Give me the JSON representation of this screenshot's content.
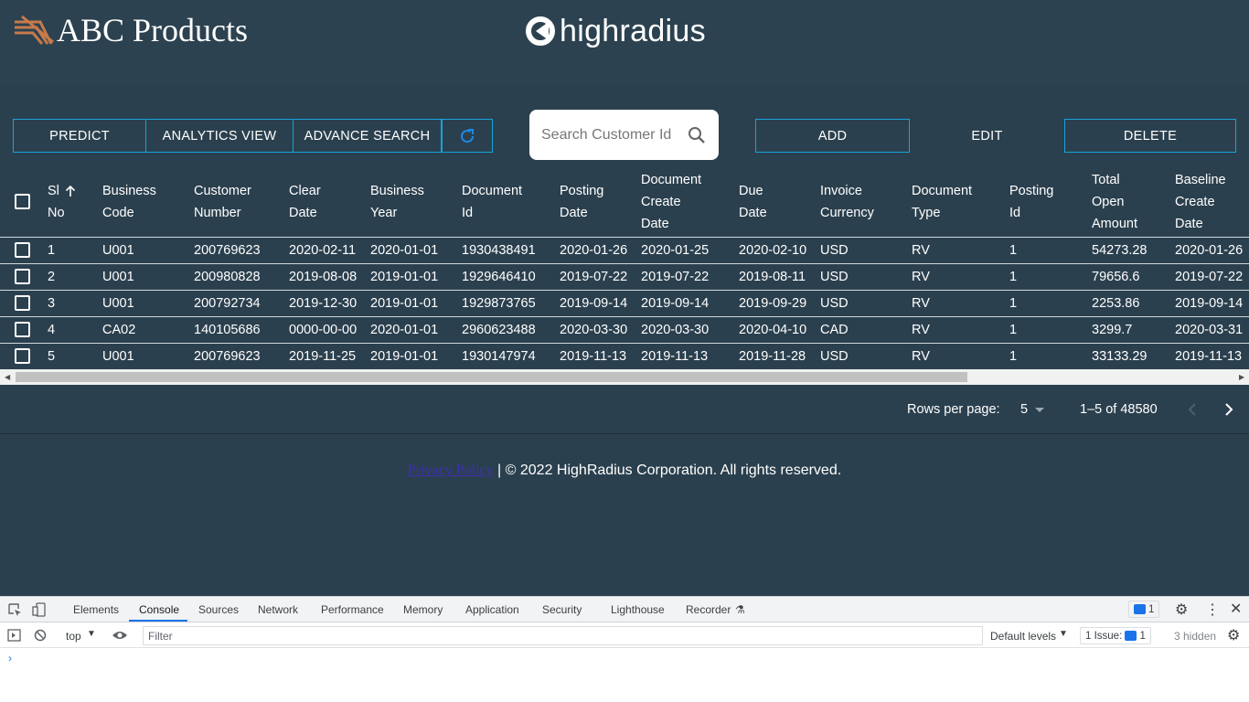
{
  "header": {
    "brand": "ABC Products",
    "partner_logo": "highradius"
  },
  "toolbar": {
    "predict": "PREDICT",
    "analytics": "ANALYTICS VIEW",
    "advance_search": "ADVANCE SEARCH",
    "refresh_icon": "refresh-icon",
    "add": "ADD",
    "edit": "EDIT",
    "delete": "DELETE"
  },
  "search": {
    "placeholder": "Search Customer Id",
    "icon": "search-icon"
  },
  "table": {
    "columns": [
      [
        "Sl",
        "No"
      ],
      [
        "Business",
        "Code"
      ],
      [
        "Customer",
        "Number"
      ],
      [
        "Clear",
        "Date"
      ],
      [
        "Business",
        "Year"
      ],
      [
        "Document",
        "Id"
      ],
      [
        "Posting",
        "Date"
      ],
      [
        "Document",
        "Create",
        "Date"
      ],
      [
        "Due",
        "Date"
      ],
      [
        "Invoice",
        "Currency"
      ],
      [
        "Document",
        "Type"
      ],
      [
        "Posting",
        "Id"
      ],
      [
        "Total",
        "Open",
        "Amount"
      ],
      [
        "Baseline",
        "Create",
        "Date"
      ]
    ],
    "rows": [
      [
        "1",
        "U001",
        "200769623",
        "2020-02-11",
        "2020-01-01",
        "1930438491",
        "2020-01-26",
        "2020-01-25",
        "2020-02-10",
        "USD",
        "RV",
        "1",
        "54273.28",
        "2020-01-26"
      ],
      [
        "2",
        "U001",
        "200980828",
        "2019-08-08",
        "2019-01-01",
        "1929646410",
        "2019-07-22",
        "2019-07-22",
        "2019-08-11",
        "USD",
        "RV",
        "1",
        "79656.6",
        "2019-07-22"
      ],
      [
        "3",
        "U001",
        "200792734",
        "2019-12-30",
        "2019-01-01",
        "1929873765",
        "2019-09-14",
        "2019-09-14",
        "2019-09-29",
        "USD",
        "RV",
        "1",
        "2253.86",
        "2019-09-14"
      ],
      [
        "4",
        "CA02",
        "140105686",
        "0000-00-00",
        "2020-01-01",
        "2960623488",
        "2020-03-30",
        "2020-03-30",
        "2020-04-10",
        "CAD",
        "RV",
        "1",
        "3299.7",
        "2020-03-31"
      ],
      [
        "5",
        "U001",
        "200769623",
        "2019-11-25",
        "2019-01-01",
        "1930147974",
        "2019-11-13",
        "2019-11-13",
        "2019-11-28",
        "USD",
        "RV",
        "1",
        "33133.29",
        "2019-11-13"
      ]
    ]
  },
  "pagination": {
    "rows_label": "Rows per page:",
    "rows_value": "5",
    "range": "1–5 of 48580"
  },
  "footer": {
    "link": "Privacy Policy",
    "text": "| © 2022 HighRadius Corporation. All rights reserved."
  },
  "devtools": {
    "tabs": [
      "Elements",
      "Console",
      "Sources",
      "Network",
      "Performance",
      "Memory",
      "Application",
      "Security",
      "Lighthouse",
      "Recorder"
    ],
    "active_tab": "Console",
    "messages_badge": "1",
    "context": "top",
    "filter_placeholder": "Filter",
    "levels": "Default levels",
    "issues_label": "1 Issue:",
    "issues_count": "1",
    "hidden": "3 hidden",
    "prompt": "›"
  },
  "colors": {
    "background": "#2c4250",
    "accent_border": "#15a4dd",
    "devtools_blue": "#1a73e8"
  }
}
